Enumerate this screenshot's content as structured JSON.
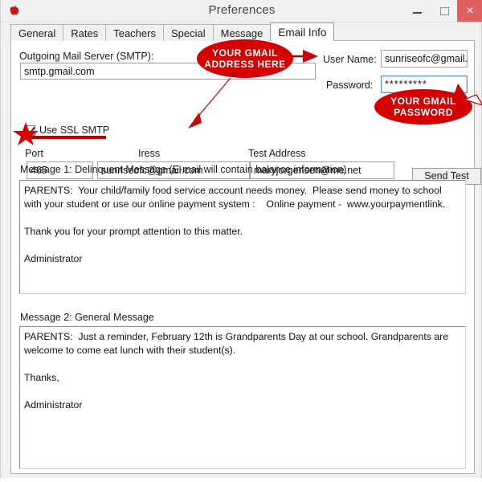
{
  "window": {
    "title": "Preferences",
    "app_icon": "apple-icon",
    "minimize_label": "–",
    "maximize_label": "□",
    "close_label": "×"
  },
  "tabs": [
    {
      "label": "General",
      "active": false
    },
    {
      "label": "Rates",
      "active": false
    },
    {
      "label": "Teachers",
      "active": false
    },
    {
      "label": "Special",
      "active": false
    },
    {
      "label": "Message",
      "active": false
    },
    {
      "label": "Email Info",
      "active": true
    }
  ],
  "form": {
    "smtp_label": "Outgoing Mail Server (SMTP):",
    "smtp_value": "smtp.gmail.com",
    "ssl_checkbox_label": "Use SSL SMTP",
    "ssl_checked": true,
    "port_label": "Port",
    "port_value": "465",
    "address_label": "Iress",
    "address_value": "sunriseofc@gmail.com",
    "test_address_label": "Test Address",
    "test_address_value": "maryjorgensen@me.net",
    "send_test_label": "Send Test",
    "username_label": "User Name:",
    "username_value": "sunriseofc@gmail.c",
    "password_label": "Password:",
    "password_value": "*********"
  },
  "messages": {
    "message1_label": "Message 1: Delinquent Message (E-mail will contain balance information)",
    "message1_body": "PARENTS:  Your child/family food service account needs money.  Please send money to school with your student or use our online payment system :    Online payment -  www.yourpaymentlink.\n\nThank you for your prompt attention to this matter.\n\nAdministrator",
    "message2_label": "Message 2: General Message",
    "message2_body": "PARENTS:  Just a reminder, February 12th is Grandparents Day at our school. Grandparents are welcome to come eat lunch with their student(s).\n\nThanks,\n\nAdministrator"
  },
  "annotations": {
    "accent_color": "#cc0000",
    "bubble1_line1": "YOUR GMAIL",
    "bubble1_line2": "ADDRESS HERE",
    "bubble2_line1": "YOUR GMAIL",
    "bubble2_line2": "PASSWORD"
  }
}
